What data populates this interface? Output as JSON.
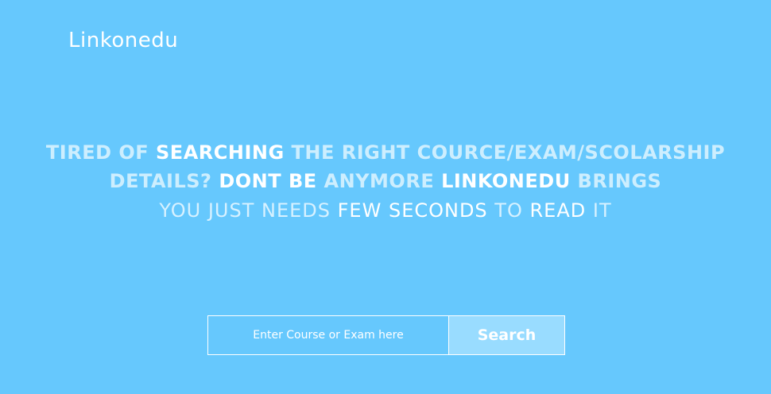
{
  "brand": {
    "logo_text": "Linkonedu"
  },
  "hero": {
    "line1": {
      "part1": "Tired of ",
      "part2": "Searching",
      "part3": " the right cource/exam/scolarship"
    },
    "line2": {
      "part1": "details? ",
      "part2": "dont be",
      "part3": " anymore ",
      "part4": "Linkonedu",
      "part5": " brings"
    },
    "line3": {
      "part1": "you just needs ",
      "part2": "few seconds",
      "part3": " to ",
      "part4": "read",
      "part5": " it"
    }
  },
  "search": {
    "placeholder": "Enter Course or Exam here",
    "value": "",
    "button_label": "Search"
  },
  "colors": {
    "background": "#66c8fd",
    "button_background": "#99dcff",
    "text_primary": "#ffffff",
    "text_muted": "#cdeefe"
  }
}
